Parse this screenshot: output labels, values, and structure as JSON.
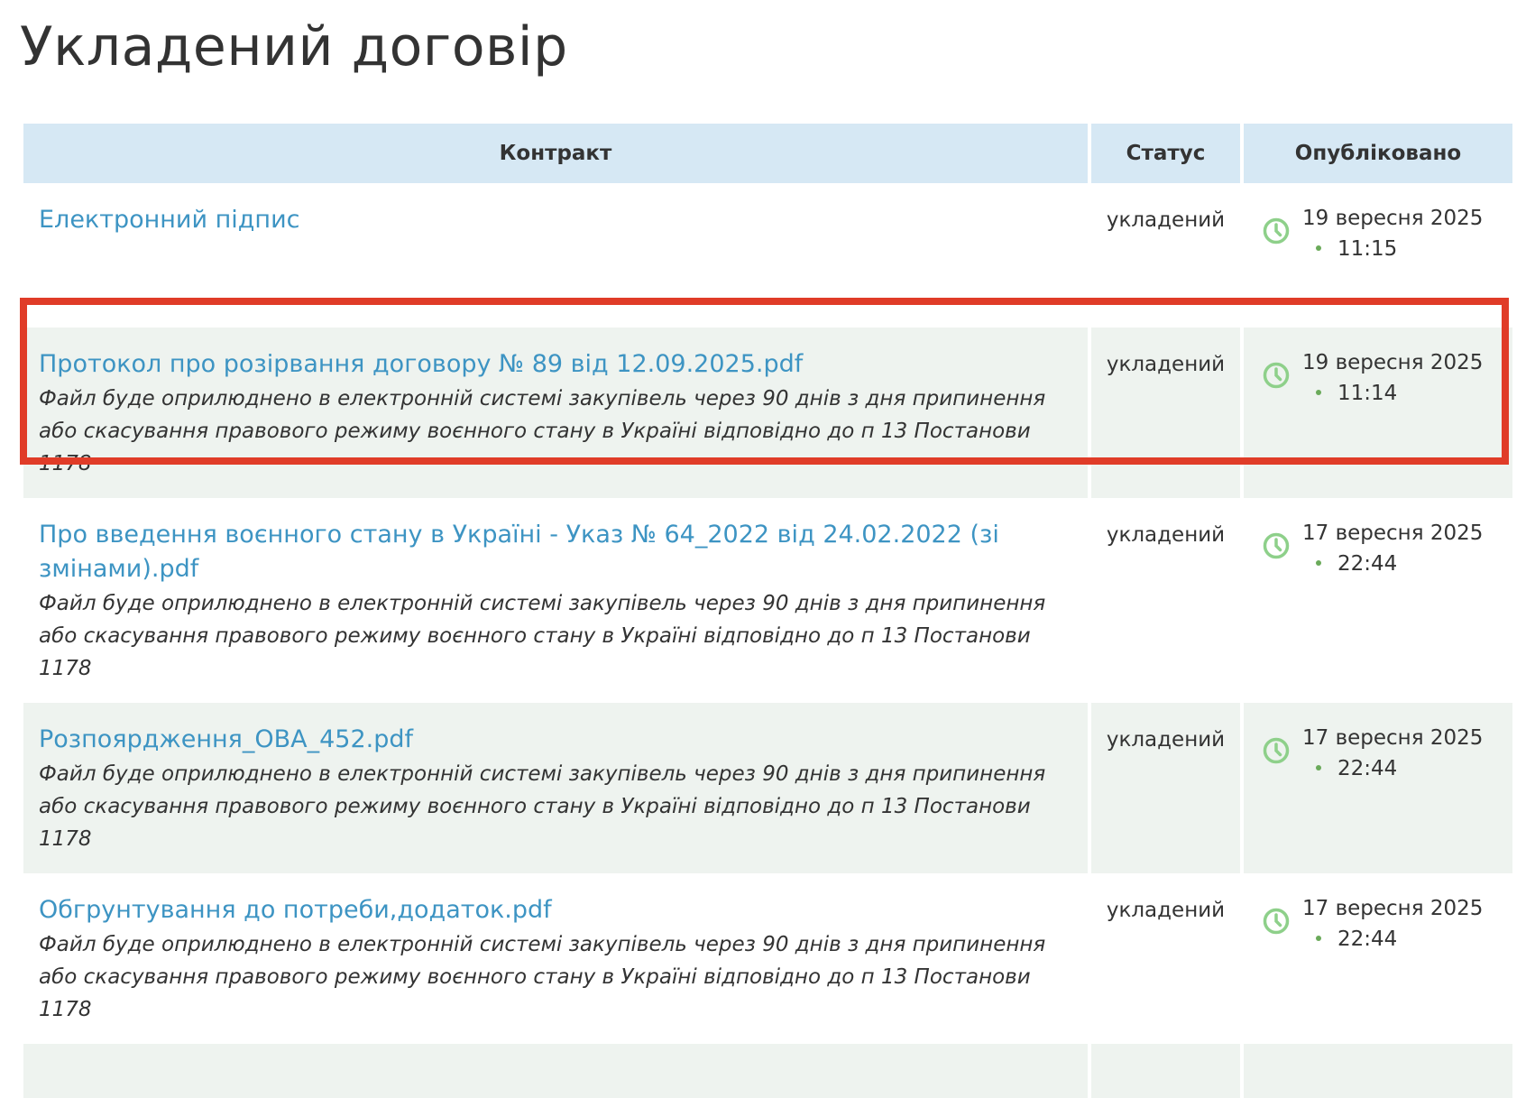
{
  "page_title": "Укладений договір",
  "table": {
    "headers": {
      "contract": "Контракт",
      "status": "Статус",
      "published": "Опубліковано"
    },
    "rows": [
      {
        "title": "Електронний підпис",
        "note": "",
        "status": "укладений",
        "date": "19 вересня 2025",
        "time": "11:15"
      },
      {
        "title": "Протокол про розірвання договору № 89 від 12.09.2025.pdf",
        "note": "Файл буде оприлюднено в електронній системі закупівель через 90 днів з дня припинення або скасування правового режиму воєнного стану в Україні відповідно до п 13 Постанови 1178",
        "status": "укладений",
        "date": "19 вересня 2025",
        "time": "11:14",
        "highlighted": true
      },
      {
        "title": "Про введення воєнного стану в Україні - Указ № 64_2022 від 24.02.2022 (зі змінами).pdf",
        "note": "Файл буде оприлюднено в електронній системі закупівель через 90 днів з дня припинення або скасування правового режиму воєнного стану в Україні відповідно до п 13 Постанови 1178",
        "status": "укладений",
        "date": "17 вересня 2025",
        "time": "22:44"
      },
      {
        "title": "Розпоярдження_ОВА_452.pdf",
        "note": "Файл буде оприлюднено в електронній системі закупівель через 90 днів з дня припинення або скасування правового режиму воєнного стану в Україні відповідно до п 13 Постанови 1178",
        "status": "укладений",
        "date": "17 вересня 2025",
        "time": "22:44"
      },
      {
        "title": "Обгрунтування до потреби,додаток.pdf",
        "note": "Файл буде оприлюднено в електронній системі закупівель через 90 днів з дня припинення або скасування правового режиму воєнного стану в Україні відповідно до п 13 Постанови 1178",
        "status": "укладений",
        "date": "17 вересня 2025",
        "time": "22:44"
      }
    ]
  },
  "colors": {
    "link": "#3d94c3",
    "header_bg": "#d6e8f4",
    "shaded_row_bg": "#eef3ef",
    "clock_icon": "#8ed08a",
    "highlight_border": "#e03c28"
  },
  "icons": {
    "published": "clock-icon"
  }
}
